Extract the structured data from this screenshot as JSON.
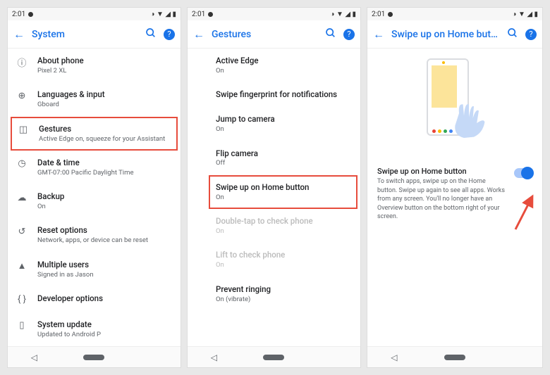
{
  "status": {
    "time": "2:01"
  },
  "screens": [
    {
      "title": "System",
      "items": [
        {
          "icon": "info",
          "primary": "About phone",
          "secondary": "Pixel 2 XL"
        },
        {
          "icon": "globe",
          "primary": "Languages & input",
          "secondary": "Gboard"
        },
        {
          "icon": "gestures",
          "primary": "Gestures",
          "secondary": "Active Edge on, squeeze for your Assistant",
          "highlight": true
        },
        {
          "icon": "clock",
          "primary": "Date & time",
          "secondary": "GMT-07:00 Pacific Daylight Time"
        },
        {
          "icon": "backup",
          "primary": "Backup",
          "secondary": "On"
        },
        {
          "icon": "reset",
          "primary": "Reset options",
          "secondary": "Network, apps, or device can be reset"
        },
        {
          "icon": "user",
          "primary": "Multiple users",
          "secondary": "Signed in as Jason"
        },
        {
          "icon": "braces",
          "primary": "Developer options",
          "secondary": ""
        },
        {
          "icon": "phone",
          "primary": "System update",
          "secondary": "Updated to Android P"
        }
      ]
    },
    {
      "title": "Gestures",
      "items": [
        {
          "primary": "Active Edge",
          "secondary": "On"
        },
        {
          "primary": "Swipe fingerprint for notifications",
          "secondary": ""
        },
        {
          "primary": "Jump to camera",
          "secondary": "On"
        },
        {
          "primary": "Flip camera",
          "secondary": "Off"
        },
        {
          "primary": "Swipe up on Home button",
          "secondary": "On",
          "highlight": true
        },
        {
          "primary": "Double-tap to check phone",
          "secondary": "On",
          "disabled": true
        },
        {
          "primary": "Lift to check phone",
          "secondary": "On",
          "disabled": true
        },
        {
          "primary": "Prevent ringing",
          "secondary": "On (vibrate)"
        }
      ]
    },
    {
      "title": "Swipe up on Home butt...",
      "detail": {
        "title": "Swipe up on Home button",
        "desc": "To switch apps, swipe up on the Home button. Swipe up again to see all apps. Works from any screen. You'll no longer have an Overview button on the bottom right of your screen.",
        "toggle": true
      }
    }
  ]
}
